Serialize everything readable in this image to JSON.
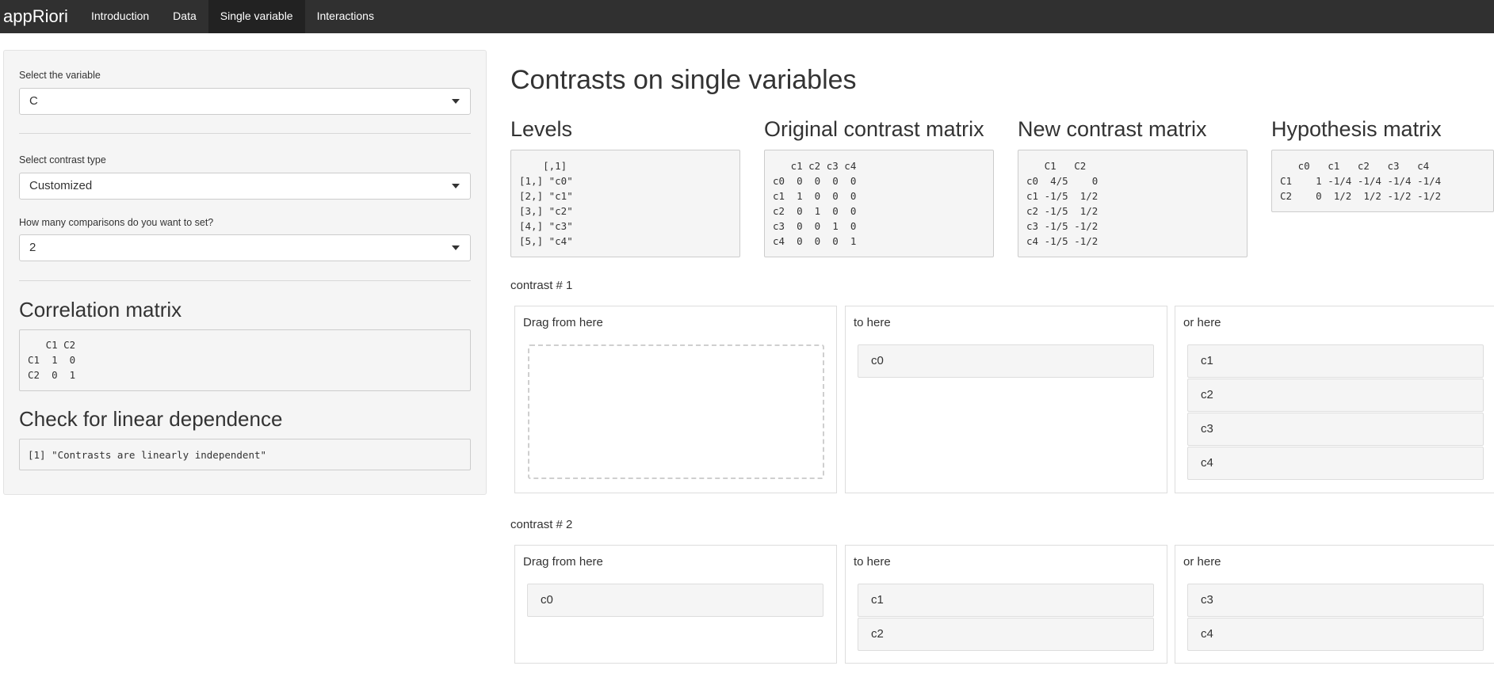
{
  "navbar": {
    "brand": "appRiori",
    "tabs": [
      {
        "label": "Introduction",
        "active": false
      },
      {
        "label": "Data",
        "active": false
      },
      {
        "label": "Single variable",
        "active": true
      },
      {
        "label": "Interactions",
        "active": false
      }
    ]
  },
  "sidebar": {
    "variable_label": "Select the variable",
    "variable_value": "C",
    "contrast_type_label": "Select contrast type",
    "contrast_type_value": "Customized",
    "comparisons_label": "How many comparisons do you want to set?",
    "comparisons_value": "2",
    "correlation_title": "Correlation matrix",
    "correlation_matrix": "   C1 C2\nC1  1  0\nC2  0  1",
    "dependence_title": "Check for linear dependence",
    "dependence_result": "[1] \"Contrasts are linearly independent\""
  },
  "main": {
    "title": "Contrasts on single variables",
    "levels_title": "Levels",
    "levels_output": "    [,1]\n[1,] \"c0\"\n[2,] \"c1\"\n[3,] \"c2\"\n[4,] \"c3\"\n[5,] \"c4\"",
    "original_title": "Original contrast matrix",
    "original_output": "   c1 c2 c3 c4\nc0  0  0  0  0\nc1  1  0  0  0\nc2  0  1  0  0\nc3  0  0  1  0\nc4  0  0  0  1",
    "new_title": "New contrast matrix",
    "new_output": "   C1   C2\nc0  4/5    0\nc1 -1/5  1/2\nc2 -1/5  1/2\nc3 -1/5 -1/2\nc4 -1/5 -1/2",
    "hypothesis_title": "Hypothesis matrix",
    "hypothesis_output": "   c0   c1   c2   c3   c4\nC1    1 -1/4 -1/4 -1/4 -1/4\nC2    0  1/2  1/2 -1/2 -1/2",
    "contrasts": [
      {
        "label": "contrast # 1",
        "drag_from": {
          "title": "Drag from here",
          "items": []
        },
        "to_here": {
          "title": "to here",
          "items": [
            "c0"
          ]
        },
        "or_here": {
          "title": "or here",
          "items": [
            "c1",
            "c2",
            "c3",
            "c4"
          ]
        }
      },
      {
        "label": "contrast # 2",
        "drag_from": {
          "title": "Drag from here",
          "items": [
            "c0"
          ]
        },
        "to_here": {
          "title": "to here",
          "items": [
            "c1",
            "c2"
          ]
        },
        "or_here": {
          "title": "or here",
          "items": [
            "c3",
            "c4"
          ]
        }
      }
    ]
  }
}
